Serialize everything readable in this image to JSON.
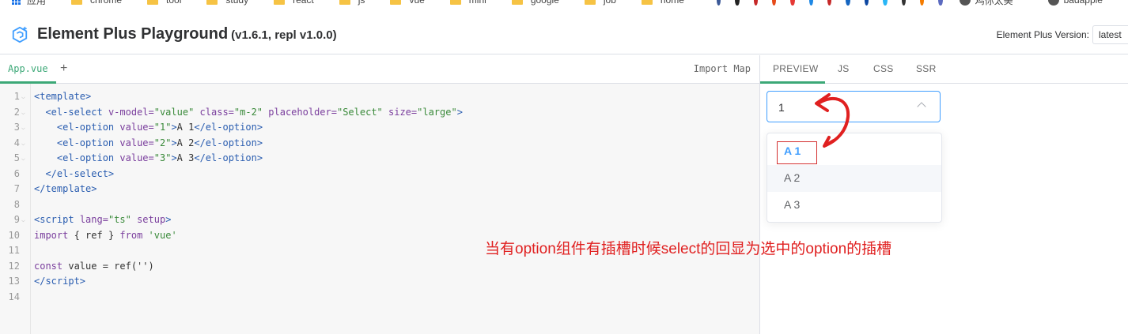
{
  "bookmarks": [
    {
      "label": "应用",
      "kind": "apps"
    },
    {
      "label": "chrome",
      "kind": "folder"
    },
    {
      "label": "tool",
      "kind": "folder"
    },
    {
      "label": "study",
      "kind": "folder"
    },
    {
      "label": "react",
      "kind": "folder"
    },
    {
      "label": "js",
      "kind": "folder"
    },
    {
      "label": "vue",
      "kind": "folder"
    },
    {
      "label": "mini",
      "kind": "folder"
    },
    {
      "label": "google",
      "kind": "folder"
    },
    {
      "label": "job",
      "kind": "folder"
    },
    {
      "label": "home",
      "kind": "folder"
    },
    {
      "label": "鸡你太美",
      "kind": "site"
    },
    {
      "label": "badapple",
      "kind": "site"
    }
  ],
  "header": {
    "title": "Element Plus Playground",
    "version_note": "(v1.6.1, repl v1.0.0)",
    "version_label": "Element Plus Version:",
    "version_value": "latest"
  },
  "editor": {
    "tab_label": "App.vue",
    "add_tab": "+",
    "import_map": "Import Map",
    "lines": [
      {
        "n": "1",
        "fold": true,
        "html": "<span class='tag'>&lt;template&gt;</span>"
      },
      {
        "n": "2",
        "fold": true,
        "html": "  <span class='tag'>&lt;el-select</span> <span class='attr'>v-model=</span><span class='str'>\"value\"</span> <span class='attr'>class=</span><span class='str'>\"m-2\"</span> <span class='attr'>placeholder=</span><span class='str'>\"Select\"</span> <span class='attr'>size=</span><span class='str'>\"large\"</span><span class='tag'>&gt;</span>"
      },
      {
        "n": "3",
        "fold": true,
        "html": "    <span class='tag'>&lt;el-option</span> <span class='attr'>value=</span><span class='str'>\"1\"</span><span class='tag'>&gt;</span><span class='plain'>A 1</span><span class='tag'>&lt;/el-option&gt;</span>"
      },
      {
        "n": "4",
        "fold": true,
        "html": "    <span class='tag'>&lt;el-option</span> <span class='attr'>value=</span><span class='str'>\"2\"</span><span class='tag'>&gt;</span><span class='plain'>A 2</span><span class='tag'>&lt;/el-option&gt;</span>"
      },
      {
        "n": "5",
        "fold": true,
        "html": "    <span class='tag'>&lt;el-option</span> <span class='attr'>value=</span><span class='str'>\"3\"</span><span class='tag'>&gt;</span><span class='plain'>A 3</span><span class='tag'>&lt;/el-option&gt;</span>"
      },
      {
        "n": "6",
        "fold": false,
        "html": "  <span class='tag'>&lt;/el-select&gt;</span>"
      },
      {
        "n": "7",
        "fold": false,
        "html": "<span class='tag'>&lt;/template&gt;</span>"
      },
      {
        "n": "8",
        "fold": false,
        "html": ""
      },
      {
        "n": "9",
        "fold": true,
        "html": "<span class='tag'>&lt;script</span> <span class='attr'>lang=</span><span class='str'>\"ts\"</span> <span class='attr'>setup</span><span class='tag'>&gt;</span>"
      },
      {
        "n": "10",
        "fold": false,
        "html": "<span class='kw'>import</span> <span class='plain'>{ ref }</span> <span class='kw'>from</span> <span class='str'>'vue'</span>"
      },
      {
        "n": "11",
        "fold": false,
        "html": ""
      },
      {
        "n": "12",
        "fold": false,
        "html": "<span class='kw'>const</span> <span class='plain'>value = ref('')</span>"
      },
      {
        "n": "13",
        "fold": false,
        "html": "<span class='tag'>&lt;/script&gt;</span>"
      },
      {
        "n": "14",
        "fold": false,
        "html": ""
      }
    ]
  },
  "preview": {
    "tabs": [
      "PREVIEW",
      "JS",
      "CSS",
      "SSR"
    ],
    "select_value": "1",
    "options": [
      {
        "label": "A 1",
        "state": "selected"
      },
      {
        "label": "A 2",
        "state": "hover"
      },
      {
        "label": "A 3",
        "state": "normal"
      }
    ]
  },
  "annotation": {
    "text": "当有option组件有插槽时候select的回显为选中的option的插槽",
    "color": "#e02020"
  },
  "colors": {
    "accent": "#3ca877",
    "primary": "#409eff",
    "annotation": "#e02020"
  }
}
